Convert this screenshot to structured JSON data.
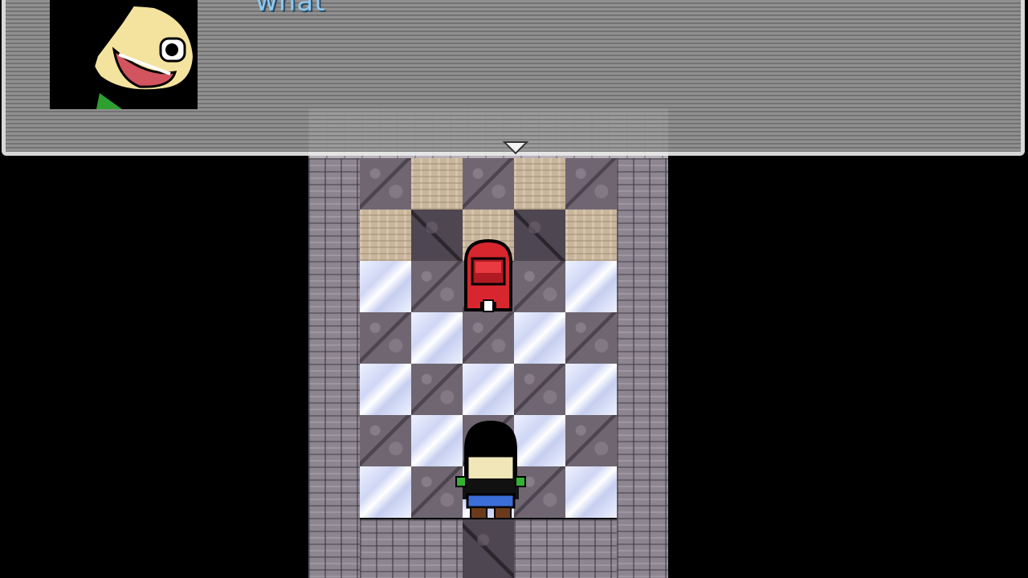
{
  "message": {
    "text": "what"
  },
  "portrait": {
    "icon": "character-portrait-face"
  },
  "window": {
    "indicator_icon": "continue-arrow-icon"
  },
  "colors": {
    "message_text": "#8ec8f0",
    "window_border": "#e8e8e8",
    "window_fill": "#8a8a8a",
    "background": "#000000"
  }
}
